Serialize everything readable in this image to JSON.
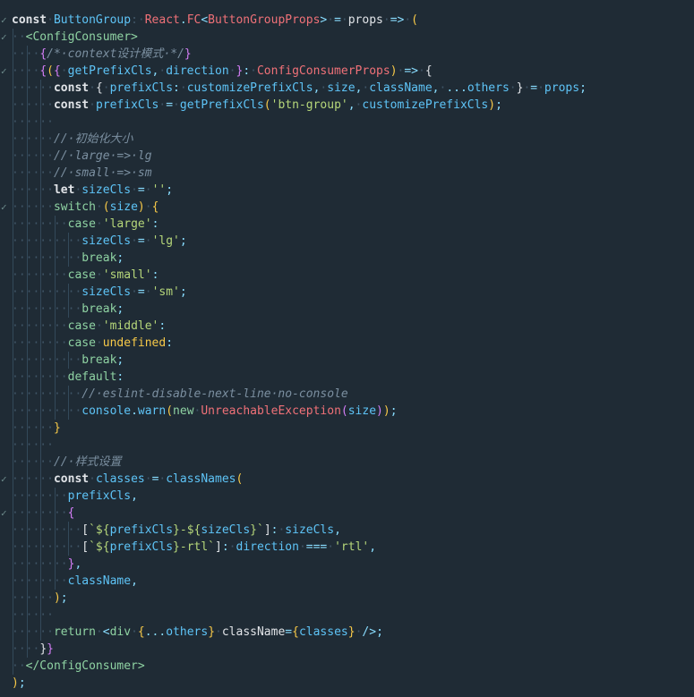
{
  "colors": {
    "background": "#1f2b35",
    "text": "#e1e4e8",
    "variable": "#5ec4f7",
    "type": "#f07178",
    "string": "#b6d77a",
    "comment": "#7b8fa0",
    "bracket_gold": "#f7c948",
    "bracket_purple": "#d47ef7",
    "fold_marker": "#6c8a8a"
  },
  "gutter": {
    "fold_icon": "chevron-down-icon"
  },
  "lines": [
    {
      "fold": true,
      "indent": 0,
      "tokens": [
        [
          "kw",
          "const"
        ],
        [
          "ws",
          "·"
        ],
        [
          "v",
          "ButtonGroup"
        ],
        [
          "ws",
          ":"
        ],
        [
          "ws",
          "·"
        ],
        [
          "t",
          "React"
        ],
        [
          "p",
          "."
        ],
        [
          "t",
          "FC"
        ],
        [
          "p",
          "<"
        ],
        [
          "t",
          "ButtonGroupProps"
        ],
        [
          "p",
          ">"
        ],
        [
          "ws",
          "·"
        ],
        [
          "p",
          "="
        ],
        [
          "ws",
          "·"
        ],
        [
          "tx",
          "props"
        ],
        [
          "ws",
          "·"
        ],
        [
          "p",
          "=>"
        ],
        [
          "ws",
          "·"
        ],
        [
          "y",
          "("
        ]
      ]
    },
    {
      "fold": true,
      "indent": 1,
      "tokens": [
        [
          "kb",
          "<ConfigConsumer>"
        ]
      ]
    },
    {
      "fold": false,
      "indent": 2,
      "tokens": [
        [
          "m",
          "{"
        ],
        [
          "c",
          "/*·context"
        ],
        [
          "c",
          "设计模式"
        ],
        [
          "c",
          "·*/"
        ],
        [
          "m",
          "}"
        ]
      ]
    },
    {
      "fold": true,
      "indent": 2,
      "tokens": [
        [
          "m",
          "{"
        ],
        [
          "y",
          "("
        ],
        [
          "m",
          "{"
        ],
        [
          "ws",
          "·"
        ],
        [
          "f",
          "getPrefixCls"
        ],
        [
          "p",
          ","
        ],
        [
          "ws",
          "·"
        ],
        [
          "v",
          "direction"
        ],
        [
          "ws",
          "·"
        ],
        [
          "m",
          "}"
        ],
        [
          "p",
          ":"
        ],
        [
          "ws",
          "·"
        ],
        [
          "t",
          "ConfigConsumerProps"
        ],
        [
          "y",
          ")"
        ],
        [
          "ws",
          "·"
        ],
        [
          "p",
          "=>"
        ],
        [
          "ws",
          "·"
        ],
        [
          "tx",
          "{"
        ]
      ]
    },
    {
      "fold": false,
      "indent": 3,
      "tokens": [
        [
          "kw",
          "const"
        ],
        [
          "ws",
          "·"
        ],
        [
          "tx",
          "{"
        ],
        [
          "ws",
          "·"
        ],
        [
          "v",
          "prefixCls"
        ],
        [
          "p",
          ":"
        ],
        [
          "ws",
          "·"
        ],
        [
          "v",
          "customizePrefixCls"
        ],
        [
          "p",
          ","
        ],
        [
          "ws",
          "·"
        ],
        [
          "v",
          "size"
        ],
        [
          "p",
          ","
        ],
        [
          "ws",
          "·"
        ],
        [
          "v",
          "className"
        ],
        [
          "p",
          ","
        ],
        [
          "ws",
          "·"
        ],
        [
          "p",
          "..."
        ],
        [
          "v",
          "others"
        ],
        [
          "ws",
          "·"
        ],
        [
          "tx",
          "}"
        ],
        [
          "ws",
          "·"
        ],
        [
          "p",
          "="
        ],
        [
          "ws",
          "·"
        ],
        [
          "v",
          "props"
        ],
        [
          "p",
          ";"
        ]
      ]
    },
    {
      "fold": false,
      "indent": 3,
      "tokens": [
        [
          "kw",
          "const"
        ],
        [
          "ws",
          "·"
        ],
        [
          "v",
          "prefixCls"
        ],
        [
          "ws",
          "·"
        ],
        [
          "p",
          "="
        ],
        [
          "ws",
          "·"
        ],
        [
          "f",
          "getPrefixCls"
        ],
        [
          "y",
          "("
        ],
        [
          "s",
          "'btn-group'"
        ],
        [
          "p",
          ","
        ],
        [
          "ws",
          "·"
        ],
        [
          "v",
          "customizePrefixCls"
        ],
        [
          "y",
          ")"
        ],
        [
          "p",
          ";"
        ]
      ]
    },
    {
      "fold": false,
      "indent": 3,
      "tokens": []
    },
    {
      "fold": false,
      "indent": 3,
      "tokens": [
        [
          "c",
          "//·"
        ],
        [
          "c",
          "初始化大小"
        ]
      ]
    },
    {
      "fold": false,
      "indent": 3,
      "tokens": [
        [
          "c",
          "//·large·=>·lg"
        ]
      ]
    },
    {
      "fold": false,
      "indent": 3,
      "tokens": [
        [
          "c",
          "//·small·=>·sm"
        ]
      ]
    },
    {
      "fold": false,
      "indent": 3,
      "tokens": [
        [
          "kw",
          "let"
        ],
        [
          "ws",
          "·"
        ],
        [
          "v",
          "sizeCls"
        ],
        [
          "ws",
          "·"
        ],
        [
          "p",
          "="
        ],
        [
          "ws",
          "·"
        ],
        [
          "s",
          "''"
        ],
        [
          "p",
          ";"
        ]
      ]
    },
    {
      "fold": true,
      "indent": 3,
      "tokens": [
        [
          "kb",
          "switch"
        ],
        [
          "ws",
          "·"
        ],
        [
          "y",
          "("
        ],
        [
          "v",
          "size"
        ],
        [
          "y",
          ")"
        ],
        [
          "ws",
          "·"
        ],
        [
          "y",
          "{"
        ]
      ]
    },
    {
      "fold": false,
      "indent": 4,
      "tokens": [
        [
          "kb",
          "case"
        ],
        [
          "ws",
          "·"
        ],
        [
          "s",
          "'large'"
        ],
        [
          "p",
          ":"
        ]
      ]
    },
    {
      "fold": false,
      "indent": 5,
      "tokens": [
        [
          "v",
          "sizeCls"
        ],
        [
          "ws",
          "·"
        ],
        [
          "p",
          "="
        ],
        [
          "ws",
          "·"
        ],
        [
          "s",
          "'lg'"
        ],
        [
          "p",
          ";"
        ]
      ]
    },
    {
      "fold": false,
      "indent": 5,
      "tokens": [
        [
          "kb",
          "break"
        ],
        [
          "p",
          ";"
        ]
      ]
    },
    {
      "fold": false,
      "indent": 4,
      "tokens": [
        [
          "kb",
          "case"
        ],
        [
          "ws",
          "·"
        ],
        [
          "s",
          "'small'"
        ],
        [
          "p",
          ":"
        ]
      ]
    },
    {
      "fold": false,
      "indent": 5,
      "tokens": [
        [
          "v",
          "sizeCls"
        ],
        [
          "ws",
          "·"
        ],
        [
          "p",
          "="
        ],
        [
          "ws",
          "·"
        ],
        [
          "s",
          "'sm'"
        ],
        [
          "p",
          ";"
        ]
      ]
    },
    {
      "fold": false,
      "indent": 5,
      "tokens": [
        [
          "kb",
          "break"
        ],
        [
          "p",
          ";"
        ]
      ]
    },
    {
      "fold": false,
      "indent": 4,
      "tokens": [
        [
          "kb",
          "case"
        ],
        [
          "ws",
          "·"
        ],
        [
          "s",
          "'middle'"
        ],
        [
          "p",
          ":"
        ]
      ]
    },
    {
      "fold": false,
      "indent": 4,
      "tokens": [
        [
          "kb",
          "case"
        ],
        [
          "ws",
          "·"
        ],
        [
          "y",
          "undefined"
        ],
        [
          "p",
          ":"
        ]
      ]
    },
    {
      "fold": false,
      "indent": 5,
      "tokens": [
        [
          "kb",
          "break"
        ],
        [
          "p",
          ";"
        ]
      ]
    },
    {
      "fold": false,
      "indent": 4,
      "tokens": [
        [
          "kb",
          "default"
        ],
        [
          "p",
          ":"
        ]
      ]
    },
    {
      "fold": false,
      "indent": 5,
      "tokens": [
        [
          "c",
          "//·eslint-disable-next-line·no-console"
        ]
      ]
    },
    {
      "fold": false,
      "indent": 5,
      "tokens": [
        [
          "v",
          "console"
        ],
        [
          "p",
          "."
        ],
        [
          "f",
          "warn"
        ],
        [
          "y",
          "("
        ],
        [
          "kb",
          "new"
        ],
        [
          "ws",
          "·"
        ],
        [
          "t",
          "UnreachableException"
        ],
        [
          "m",
          "("
        ],
        [
          "v",
          "size"
        ],
        [
          "m",
          ")"
        ],
        [
          "y",
          ")"
        ],
        [
          "p",
          ";"
        ]
      ]
    },
    {
      "fold": false,
      "indent": 3,
      "tokens": [
        [
          "y",
          "}"
        ]
      ]
    },
    {
      "fold": false,
      "indent": 3,
      "tokens": []
    },
    {
      "fold": false,
      "indent": 3,
      "tokens": [
        [
          "c",
          "//·"
        ],
        [
          "c",
          "样式设置"
        ]
      ]
    },
    {
      "fold": true,
      "indent": 3,
      "tokens": [
        [
          "kw",
          "const"
        ],
        [
          "ws",
          "·"
        ],
        [
          "v",
          "classes"
        ],
        [
          "ws",
          "·"
        ],
        [
          "p",
          "="
        ],
        [
          "ws",
          "·"
        ],
        [
          "f",
          "classNames"
        ],
        [
          "y",
          "("
        ]
      ]
    },
    {
      "fold": false,
      "indent": 4,
      "tokens": [
        [
          "v",
          "prefixCls"
        ],
        [
          "p",
          ","
        ]
      ]
    },
    {
      "fold": true,
      "indent": 4,
      "tokens": [
        [
          "m",
          "{"
        ]
      ]
    },
    {
      "fold": false,
      "indent": 5,
      "tokens": [
        [
          "tx",
          "["
        ],
        [
          "s",
          "`${"
        ],
        [
          "v",
          "prefixCls"
        ],
        [
          "s",
          "}-${"
        ],
        [
          "v",
          "sizeCls"
        ],
        [
          "s",
          "}`"
        ],
        [
          "tx",
          "]"
        ],
        [
          "p",
          ":"
        ],
        [
          "ws",
          "·"
        ],
        [
          "v",
          "sizeCls"
        ],
        [
          "p",
          ","
        ]
      ]
    },
    {
      "fold": false,
      "indent": 5,
      "tokens": [
        [
          "tx",
          "["
        ],
        [
          "s",
          "`${"
        ],
        [
          "v",
          "prefixCls"
        ],
        [
          "s",
          "}-rtl`"
        ],
        [
          "tx",
          "]"
        ],
        [
          "p",
          ":"
        ],
        [
          "ws",
          "·"
        ],
        [
          "v",
          "direction"
        ],
        [
          "ws",
          "·"
        ],
        [
          "p",
          "==="
        ],
        [
          "ws",
          "·"
        ],
        [
          "s",
          "'rtl'"
        ],
        [
          "p",
          ","
        ]
      ]
    },
    {
      "fold": false,
      "indent": 4,
      "tokens": [
        [
          "m",
          "}"
        ],
        [
          "p",
          ","
        ]
      ]
    },
    {
      "fold": false,
      "indent": 4,
      "tokens": [
        [
          "v",
          "className"
        ],
        [
          "p",
          ","
        ]
      ]
    },
    {
      "fold": false,
      "indent": 3,
      "tokens": [
        [
          "y",
          ")"
        ],
        [
          "p",
          ";"
        ]
      ]
    },
    {
      "fold": false,
      "indent": 3,
      "tokens": []
    },
    {
      "fold": false,
      "indent": 3,
      "tokens": [
        [
          "kb",
          "return"
        ],
        [
          "ws",
          "·"
        ],
        [
          "p",
          "<"
        ],
        [
          "kb",
          "div"
        ],
        [
          "ws",
          "·"
        ],
        [
          "y",
          "{"
        ],
        [
          "p",
          "..."
        ],
        [
          "v",
          "others"
        ],
        [
          "y",
          "}"
        ],
        [
          "ws",
          "·"
        ],
        [
          "tx",
          "className"
        ],
        [
          "p",
          "="
        ],
        [
          "y",
          "{"
        ],
        [
          "v",
          "classes"
        ],
        [
          "y",
          "}"
        ],
        [
          "ws",
          "·"
        ],
        [
          "p",
          "/>"
        ],
        [
          "p",
          ";"
        ]
      ]
    },
    {
      "fold": false,
      "indent": 2,
      "tokens": [
        [
          "tx",
          "}"
        ],
        [
          "m",
          "}"
        ]
      ]
    },
    {
      "fold": false,
      "indent": 1,
      "tokens": [
        [
          "kb",
          "</ConfigConsumer>"
        ]
      ]
    },
    {
      "fold": false,
      "indent": 0,
      "tokens": [
        [
          "y",
          ")"
        ],
        [
          "p",
          ";"
        ]
      ]
    }
  ]
}
